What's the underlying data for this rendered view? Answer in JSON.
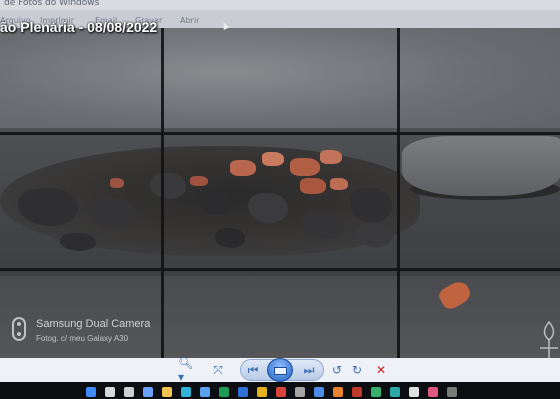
{
  "window": {
    "title": "de Fotos do Windows"
  },
  "menubar": {
    "items": [
      "Arquivo",
      "Imprimir",
      "Email",
      "Gravar",
      "Abrir"
    ]
  },
  "overlay": {
    "caption": "ão Plenária - 08/08/2022"
  },
  "watermark": {
    "icon": "dual-camera-icon",
    "line1": "Samsung Dual Camera",
    "line2": "Fotog. c/ meu Galaxy A30"
  },
  "viewer_toolbar": {
    "buttons": [
      {
        "name": "zoom-icon",
        "glyph": "🔍︎▾"
      },
      {
        "name": "actual-size-icon",
        "glyph": "⤧"
      },
      {
        "name": "previous-icon",
        "glyph": "⏮"
      },
      {
        "name": "slideshow-icon",
        "glyph": ""
      },
      {
        "name": "next-icon",
        "glyph": "⏭"
      },
      {
        "name": "rotate-left-icon",
        "glyph": "↺"
      },
      {
        "name": "rotate-right-icon",
        "glyph": "↻"
      },
      {
        "name": "delete-icon",
        "glyph": "✕"
      }
    ]
  },
  "taskbar": {
    "icons": [
      {
        "name": "start-icon",
        "color": "#3d8bff"
      },
      {
        "name": "search-icon",
        "color": "#d8d8d8"
      },
      {
        "name": "task-view-icon",
        "color": "#cfcfcf"
      },
      {
        "name": "widgets-icon",
        "color": "#6aa0ff"
      },
      {
        "name": "file-explorer-icon",
        "color": "#f2c14e"
      },
      {
        "name": "edge-icon",
        "color": "#2fb5d8"
      },
      {
        "name": "store-icon",
        "color": "#5aa2f0"
      },
      {
        "name": "excel-icon",
        "color": "#1f9a55"
      },
      {
        "name": "word-icon",
        "color": "#2f6fd8"
      },
      {
        "name": "chrome-icon",
        "color": "#e3b21c"
      },
      {
        "name": "app-red-icon",
        "color": "#d9433a"
      },
      {
        "name": "app-gray-icon",
        "color": "#a5a5a5"
      },
      {
        "name": "app-blue-icon",
        "color": "#4c8de8"
      },
      {
        "name": "app-orange-icon",
        "color": "#e8822e"
      },
      {
        "name": "photos-icon",
        "color": "#c0392b"
      },
      {
        "name": "app-green-icon",
        "color": "#38b26a"
      },
      {
        "name": "app-teal-icon",
        "color": "#2aa7a7"
      },
      {
        "name": "app-light-icon",
        "color": "#e0e0e0"
      },
      {
        "name": "app-pink-icon",
        "color": "#e05780"
      },
      {
        "name": "app-dark-icon",
        "color": "#7a7a7a"
      }
    ]
  }
}
